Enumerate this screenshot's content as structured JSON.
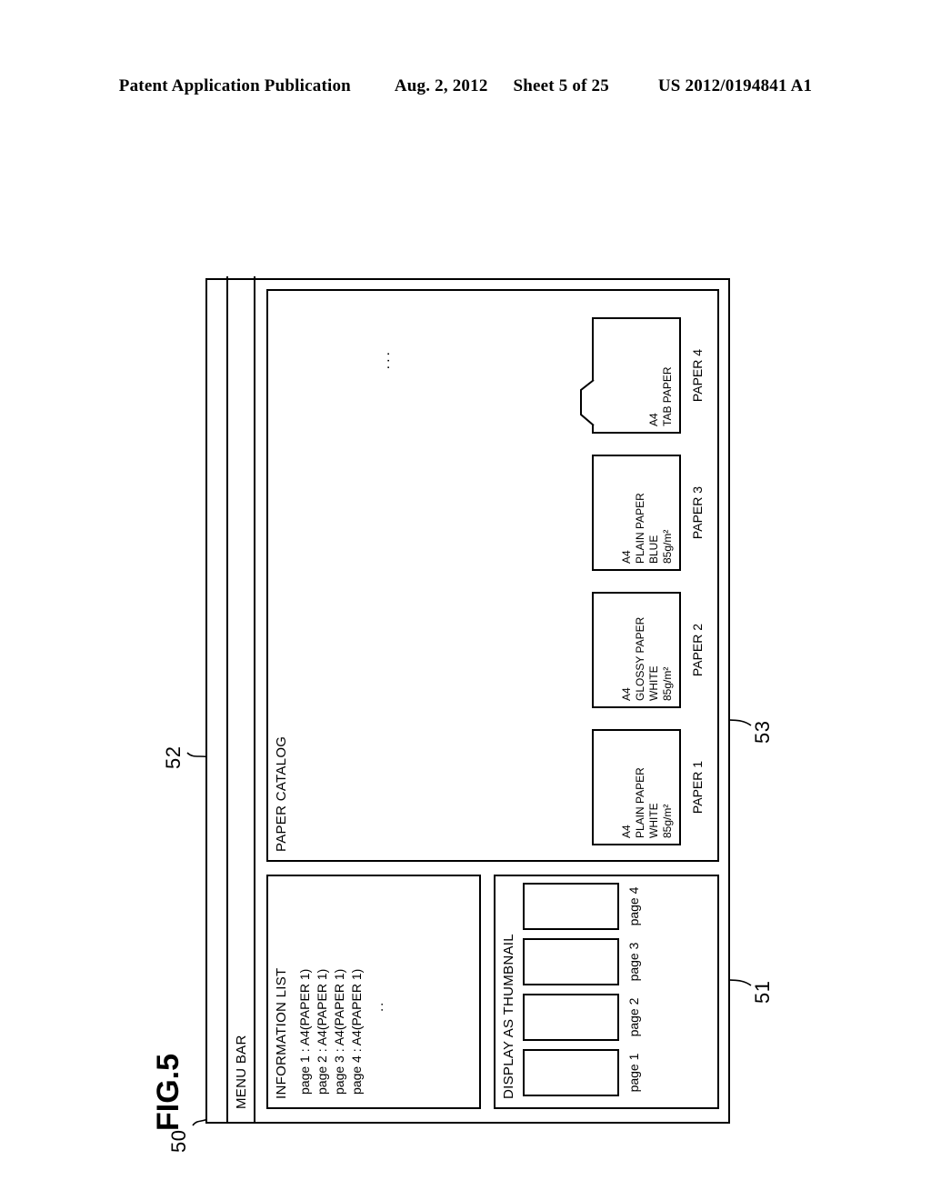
{
  "header": {
    "publication": "Patent Application Publication",
    "date": "Aug. 2, 2012",
    "sheet": "Sheet 5 of 25",
    "patent_number": "US 2012/0194841 A1"
  },
  "figure": {
    "title": "FIG.5",
    "window_ref": "50",
    "information_list_ref": "51",
    "thumbnail_ref": "52",
    "paper_catalog_ref": "53"
  },
  "window": {
    "menu_bar_label": "MENU BAR"
  },
  "information_list": {
    "title": "INFORMATION LIST",
    "items": [
      "page 1 : A4(PAPER 1)",
      "page 2 : A4(PAPER 1)",
      "page 3 : A4(PAPER 1)",
      "page 4 : A4(PAPER 1)"
    ],
    "ellipsis": ".."
  },
  "thumbnail": {
    "title": "DISPLAY AS THUMBNAIL",
    "pages": [
      {
        "label": "page 1"
      },
      {
        "label": "page 2"
      },
      {
        "label": "page 3"
      },
      {
        "label": "page 4"
      }
    ]
  },
  "paper_catalog": {
    "title": "PAPER CATALOG",
    "ellipsis": "...",
    "papers": [
      {
        "label": "PAPER 1",
        "size": "A4",
        "type": "PLAIN PAPER",
        "color": "WHITE",
        "weight": "85g/m²",
        "has_tab": false
      },
      {
        "label": "PAPER 2",
        "size": "A4",
        "type": "GLOSSY PAPER",
        "color": "WHITE",
        "weight": "85g/m²",
        "has_tab": false
      },
      {
        "label": "PAPER 3",
        "size": "A4",
        "type": "PLAIN PAPER",
        "color": "BLUE",
        "weight": "85g/m²",
        "has_tab": false
      },
      {
        "label": "PAPER 4",
        "size": "A4",
        "type": "TAB PAPER",
        "color": "",
        "weight": "",
        "has_tab": true
      }
    ]
  }
}
